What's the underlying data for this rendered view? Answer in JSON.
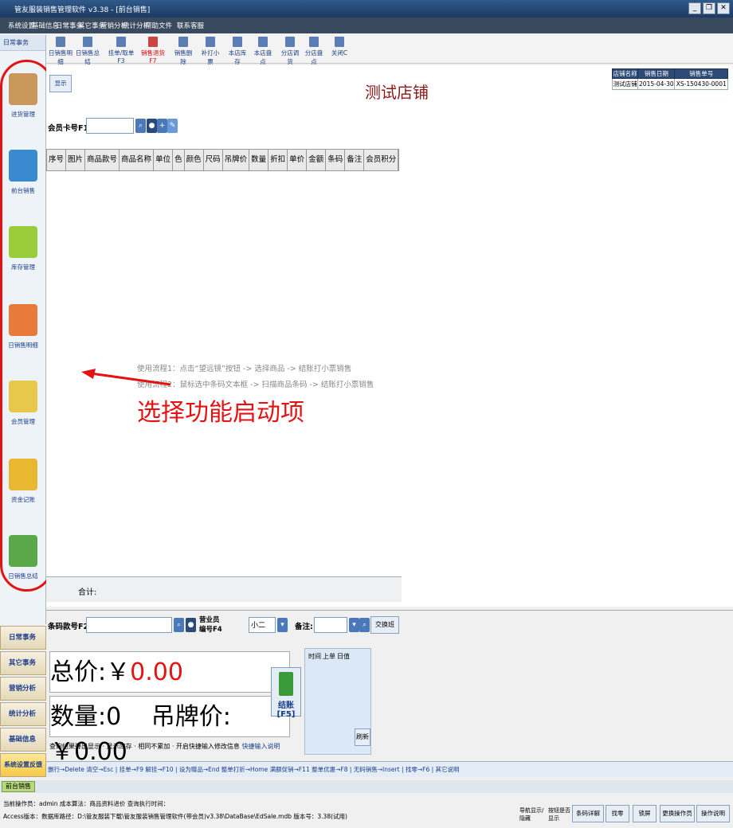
{
  "window": {
    "title": "管友服装销售管理软件 v3.38 - [前台销售]"
  },
  "menu": [
    "系统设置",
    "基础信息",
    "日常事务",
    "其它事务",
    "营销分析",
    "统计分析",
    "帮助文件",
    "联系客服"
  ],
  "toolbar": [
    "日销售明细",
    "日销售总结",
    "挂单/取单F3",
    "销售退货F7",
    "销售删除",
    "补打小票",
    "本店库存",
    "本店盘点",
    "分店调货",
    "分店盘点",
    "关闭C"
  ],
  "sidebar": {
    "header": "日常事务",
    "items": [
      "进货管理",
      "前台销售",
      "库存管理",
      "日销售明细",
      "会员管理",
      "资金记账",
      "日销售总结"
    ]
  },
  "header": {
    "show_btn": "显示",
    "shop_name": "测试店铺"
  },
  "info": {
    "headers": [
      "店铺名称",
      "销售日期",
      "销售单号"
    ],
    "shop": "测试店铺",
    "date": "2015-04-30",
    "order": "XS-150430-0001"
  },
  "member": {
    "label": "会员卡号F1:"
  },
  "grid": {
    "columns": [
      "序号",
      "图片",
      "商品款号",
      "商品名称",
      "单位",
      "色",
      "颜色",
      "尺码",
      "吊牌价",
      "数量",
      "折扣",
      "单价",
      "金额",
      "条码",
      "备注",
      "会员积分"
    ]
  },
  "hints": [
    "使用流程1：点击“望远镜”按钮 -> 选择商品 -> 结账打小票销售",
    "使用流程2：鼠标选中条码文本框 -> 扫描商品条码 -> 结账打小票销售"
  ],
  "annotation": "选择功能启动项",
  "totals": {
    "label": "合计:"
  },
  "entry": {
    "barcode_label": "条码款号F2:",
    "staff_label": "营业员编号F4",
    "staff_value": "小二",
    "remark_label": "备注:",
    "exchange": "交换班"
  },
  "summary": {
    "price_label": "总价:",
    "currency": "￥",
    "price_value": "0.00",
    "qty_label": "数量:",
    "qty_value": "0",
    "tag_label": "吊牌价:",
    "tag_value": "￥0.00"
  },
  "checkout": {
    "label": "结账[F5]"
  },
  "tabs": [
    "时间",
    "上单",
    "日值"
  ],
  "refresh": "刷新",
  "options": [
    "查询结果弹出显示",
    "显示库存",
    "相同不累加",
    "开启快捷输入修改信息",
    "快捷输入说明"
  ],
  "nav": [
    "日常事务",
    "其它事务",
    "营销分析",
    "统计分析",
    "基础信息",
    "系统设置反馈"
  ],
  "shortcuts": "删行→Delete 清空→Esc | 挂单→F9 解挂→F10 | 设为赠品→End 整单打折→Home 满额促销→F11 整单优惠→F8 | 无码销售→Insert | 找零→F6 | 其它说明",
  "bottom_tab": "前台销售",
  "status": {
    "line1": "当前操作员：admin  成本算法：商品资料进价  查询执行时间：",
    "line2": "Access版本：数据库路径：D:\\管友服装下载\\管友服装销售管理软件(带会员)v3.38\\DataBase\\EdSale.mdb  版本号：3.38(试用)"
  },
  "status_buttons": [
    "导航显示/隐藏",
    "按钮是否显示",
    "条码详解",
    "找零",
    "锁屏",
    "更换操作员",
    "操作说明"
  ]
}
